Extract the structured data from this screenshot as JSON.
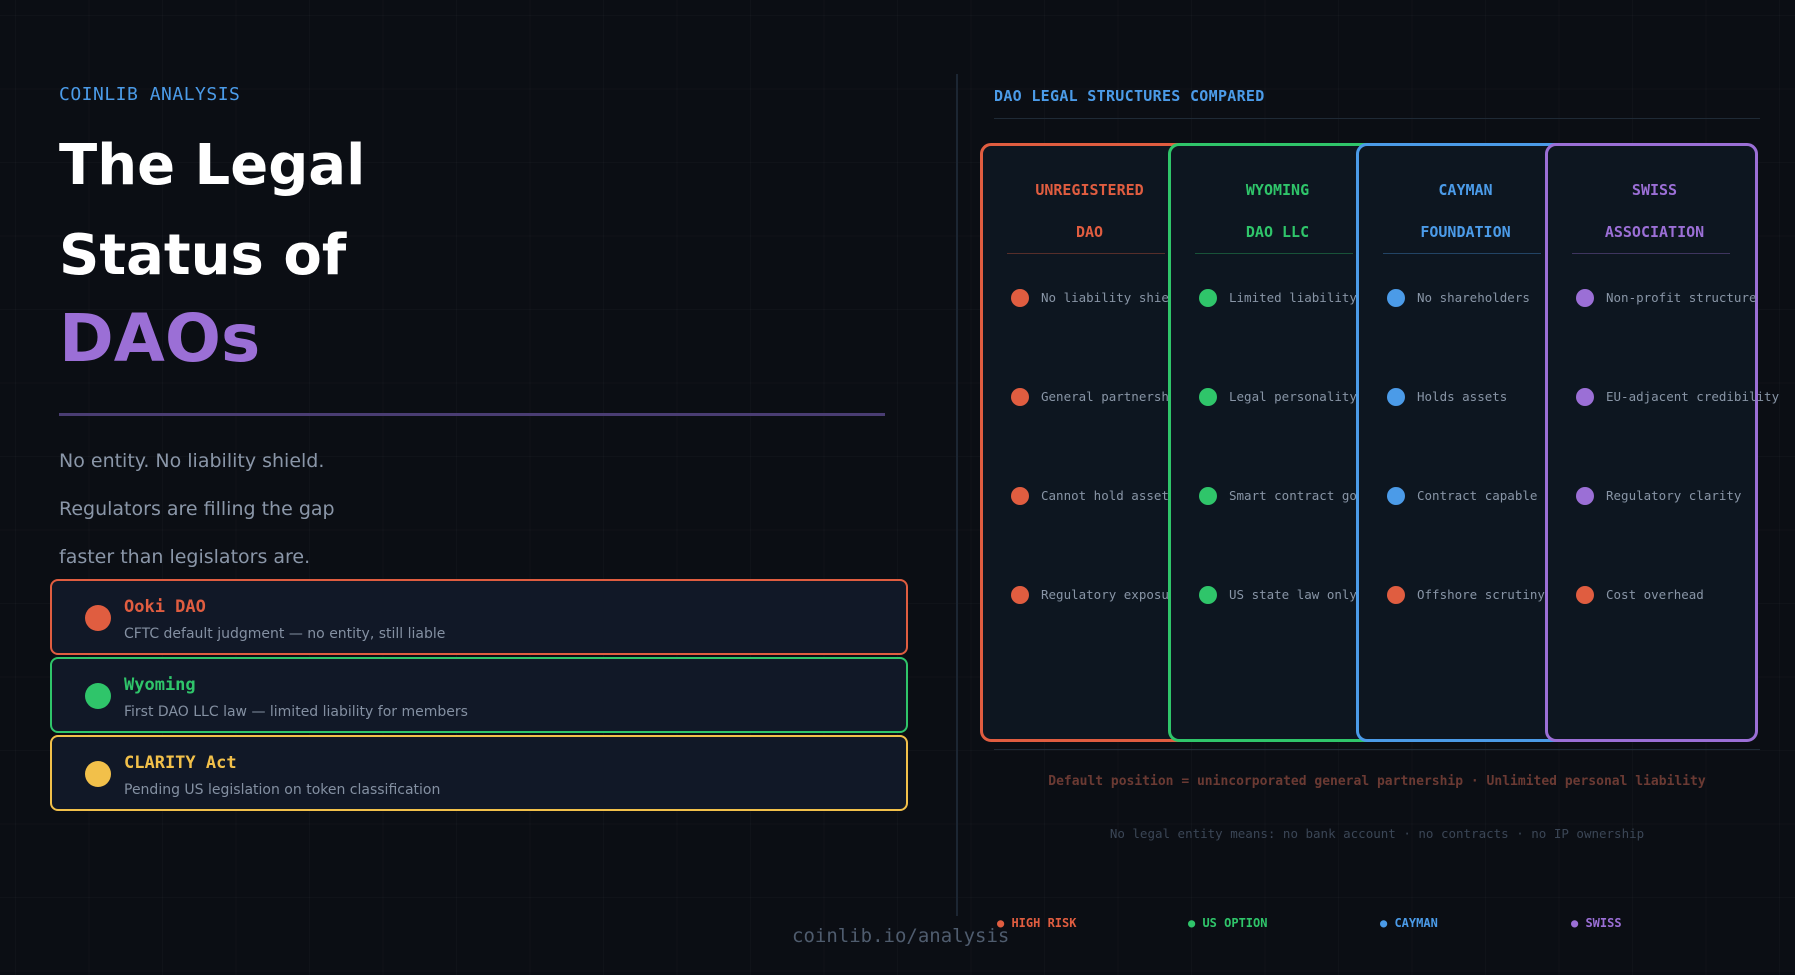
{
  "kicker": "COINLIB ANALYSIS",
  "title": {
    "line1": "The Legal",
    "line2": "Status of",
    "line3": "DAOs"
  },
  "description": {
    "line1": "No entity. No liability shield.",
    "line2": "Regulators are filling the gap",
    "line3": "faster than legislators are."
  },
  "cases": [
    {
      "title": "Ooki DAO",
      "subtitle": "CFTC default judgment — no entity, still liable",
      "color": "#e05d40"
    },
    {
      "title": "Wyoming",
      "subtitle": "First DAO LLC law — limited liability for members",
      "color": "#2fc56a"
    },
    {
      "title": "CLARITY Act",
      "subtitle": "Pending US legislation on token classification",
      "color": "#f2c04a"
    }
  ],
  "footer_url": "coinlib.io/analysis",
  "comparison": {
    "heading": "DAO LEGAL STRUCTURES COMPARED",
    "columns": [
      {
        "title_line1": "UNREGISTERED",
        "title_line2": "DAO",
        "color": "#e05d40",
        "features": [
          {
            "text": "No liability shield",
            "status": "risk"
          },
          {
            "text": "General partnership risk",
            "status": "risk"
          },
          {
            "text": "Cannot hold assets",
            "status": "risk"
          },
          {
            "text": "Regulatory exposure",
            "status": "risk"
          }
        ]
      },
      {
        "title_line1": "WYOMING",
        "title_line2": "DAO LLC",
        "color": "#2fc56a",
        "features": [
          {
            "text": "Limited liability",
            "status": "positive"
          },
          {
            "text": "Legal personality",
            "status": "positive"
          },
          {
            "text": "Smart contract gov.",
            "status": "positive"
          },
          {
            "text": "US state law only",
            "status": "positive"
          }
        ]
      },
      {
        "title_line1": "CAYMAN",
        "title_line2": "FOUNDATION",
        "color": "#4b9be8",
        "features": [
          {
            "text": "No shareholders",
            "status": "positive"
          },
          {
            "text": "Holds assets",
            "status": "positive"
          },
          {
            "text": "Contract capable",
            "status": "positive"
          },
          {
            "text": "Offshore scrutiny",
            "status": "risk"
          }
        ]
      },
      {
        "title_line1": "SWISS",
        "title_line2": "ASSOCIATION",
        "color": "#9b6fd6",
        "features": [
          {
            "text": "Non-profit structure",
            "status": "positive"
          },
          {
            "text": "EU-adjacent credibility",
            "status": "positive"
          },
          {
            "text": "Regulatory clarity",
            "status": "positive"
          },
          {
            "text": "Cost overhead",
            "status": "risk"
          }
        ]
      }
    ],
    "note_primary": "Default position = unincorporated general partnership · Unlimited personal liability",
    "note_secondary": "No legal entity means: no bank account · no contracts · no IP ownership",
    "risk_color": "#e05d40",
    "legend": [
      {
        "label": "● HIGH RISK",
        "color": "#e05d40"
      },
      {
        "label": "● US OPTION",
        "color": "#2fc56a"
      },
      {
        "label": "● CAYMAN",
        "color": "#4b9be8"
      },
      {
        "label": "● SWISS",
        "color": "#9b6fd6"
      }
    ]
  }
}
